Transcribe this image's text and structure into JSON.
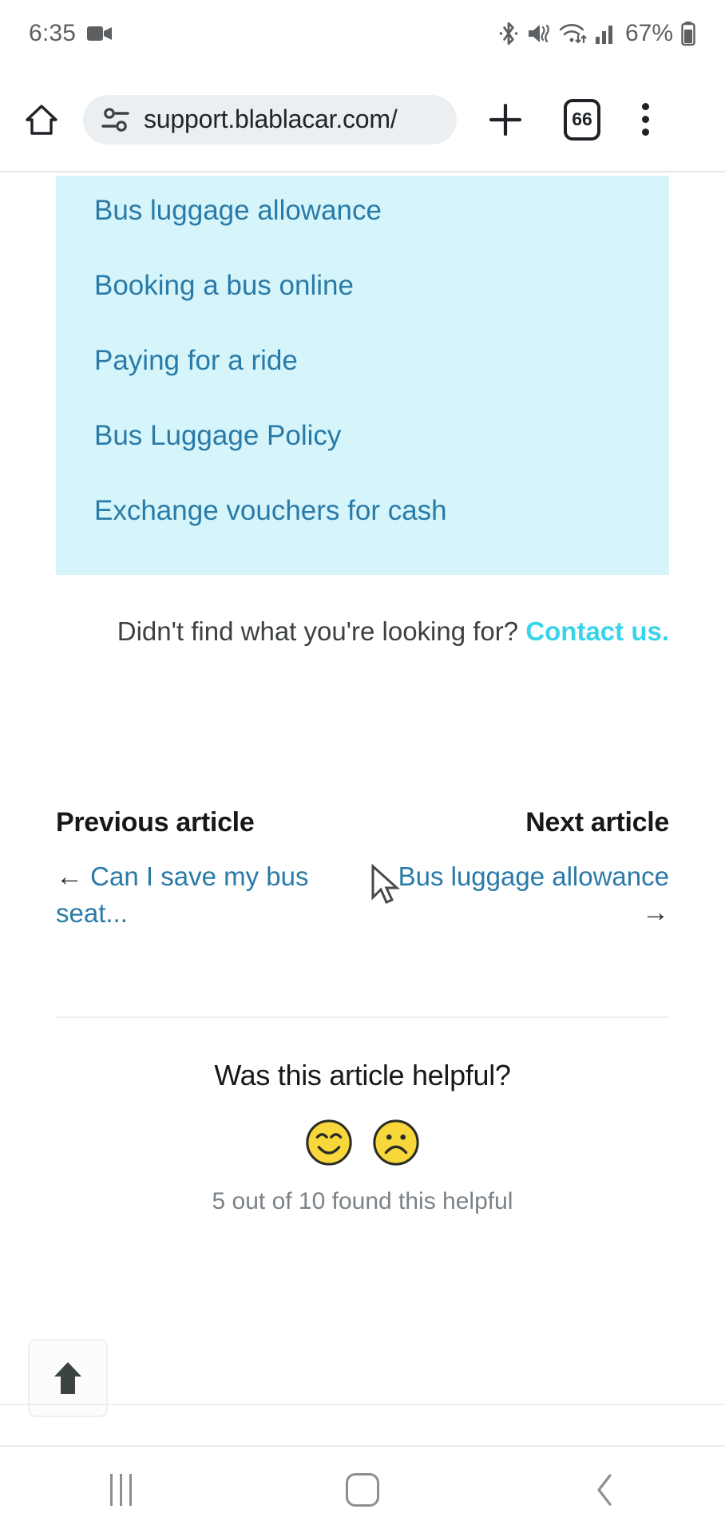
{
  "status_bar": {
    "time": "6:35",
    "battery_percent": "67%",
    "icons": [
      "screen-record-icon",
      "bluetooth-icon",
      "vibrate-mute-icon",
      "wifi-icon",
      "cellular-signal-icon",
      "battery-icon"
    ]
  },
  "browser": {
    "home_icon": "home-icon",
    "url": "support.blablacar.com/",
    "permissions_icon": "site-permissions-icon",
    "new_tab_label": "+",
    "tab_count": "66",
    "menu_icon": "overflow-menu-icon"
  },
  "related_links": {
    "background_color": "#d5f5fb",
    "link_color": "#2a7aa8",
    "items": [
      "Bus luggage allowance",
      "Booking a bus online",
      "Paying for a ride",
      "Bus Luggage Policy",
      "Exchange vouchers for cash"
    ]
  },
  "contact": {
    "prompt": "Didn't find what you're looking for?",
    "link_label": "Contact us.",
    "link_color": "#38d4ec"
  },
  "article_nav": {
    "previous": {
      "heading": "Previous article",
      "arrow": "←",
      "title": "Can I save my bus seat..."
    },
    "next": {
      "heading": "Next article",
      "arrow": "→",
      "title": "Bus luggage allowance"
    }
  },
  "feedback": {
    "question": "Was this article helpful?",
    "yes_icon": "smiling-face-icon",
    "no_icon": "frowning-face-icon",
    "count_text": "5 out of 10 found this helpful"
  },
  "scroll_top": {
    "icon": "arrow-up-icon"
  },
  "android_nav": {
    "recents_label": "recents-icon",
    "home_label": "home-icon",
    "back_label": "back-icon"
  }
}
